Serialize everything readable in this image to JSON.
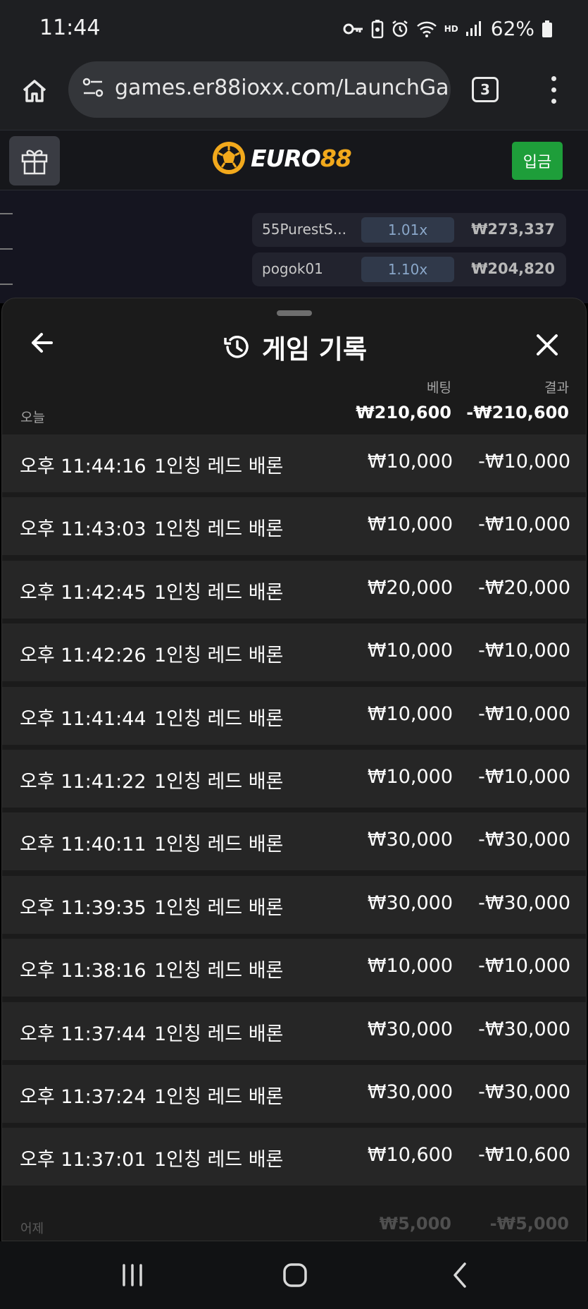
{
  "status_bar": {
    "time": "11:44",
    "signal_label": "HD",
    "battery": "62%"
  },
  "browser": {
    "url": "games.er88ioxx.com/LaunchGa",
    "tab_count": "3"
  },
  "site": {
    "logo_part1": "EURO",
    "logo_part2": "88",
    "deposit_label": "입금"
  },
  "live_bets": [
    {
      "player": "55PurestS...",
      "multiplier": "1.01x",
      "amount": "₩273,337"
    },
    {
      "player": "pogok01",
      "multiplier": "1.10x",
      "amount": "₩204,820"
    }
  ],
  "history": {
    "title": "게임 기록",
    "col_bet": "베팅",
    "col_result": "결과",
    "today": {
      "label": "오늘",
      "total_bet": "₩210,600",
      "total_result": "-₩210,600"
    },
    "rows": [
      {
        "time": "오후 11:44:16",
        "game": "1인칭 레드 배론",
        "bet": "₩10,000",
        "result": "-₩10,000"
      },
      {
        "time": "오후 11:43:03",
        "game": "1인칭 레드 배론",
        "bet": "₩10,000",
        "result": "-₩10,000"
      },
      {
        "time": "오후 11:42:45",
        "game": "1인칭 레드 배론",
        "bet": "₩20,000",
        "result": "-₩20,000"
      },
      {
        "time": "오후 11:42:26",
        "game": "1인칭 레드 배론",
        "bet": "₩10,000",
        "result": "-₩10,000"
      },
      {
        "time": "오후 11:41:44",
        "game": "1인칭 레드 배론",
        "bet": "₩10,000",
        "result": "-₩10,000"
      },
      {
        "time": "오후 11:41:22",
        "game": "1인칭 레드 배론",
        "bet": "₩10,000",
        "result": "-₩10,000"
      },
      {
        "time": "오후 11:40:11",
        "game": "1인칭 레드 배론",
        "bet": "₩30,000",
        "result": "-₩30,000"
      },
      {
        "time": "오후 11:39:35",
        "game": "1인칭 레드 배론",
        "bet": "₩30,000",
        "result": "-₩30,000"
      },
      {
        "time": "오후 11:38:16",
        "game": "1인칭 레드 배론",
        "bet": "₩10,000",
        "result": "-₩10,000"
      },
      {
        "time": "오후 11:37:44",
        "game": "1인칭 레드 배론",
        "bet": "₩30,000",
        "result": "-₩30,000"
      },
      {
        "time": "오후 11:37:24",
        "game": "1인칭 레드 배론",
        "bet": "₩30,000",
        "result": "-₩30,000"
      },
      {
        "time": "오후 11:37:01",
        "game": "1인칭 레드 배론",
        "bet": "₩10,600",
        "result": "-₩10,600"
      }
    ],
    "yesterday": {
      "label": "어제",
      "total_bet": "₩5,000",
      "total_result": "-₩5,000"
    }
  },
  "colors": {
    "accent_green": "#1e9e3a",
    "logo_yellow": "#f2a91c",
    "sheet_bg": "#1b1b1b",
    "row_bg": "#262626"
  }
}
